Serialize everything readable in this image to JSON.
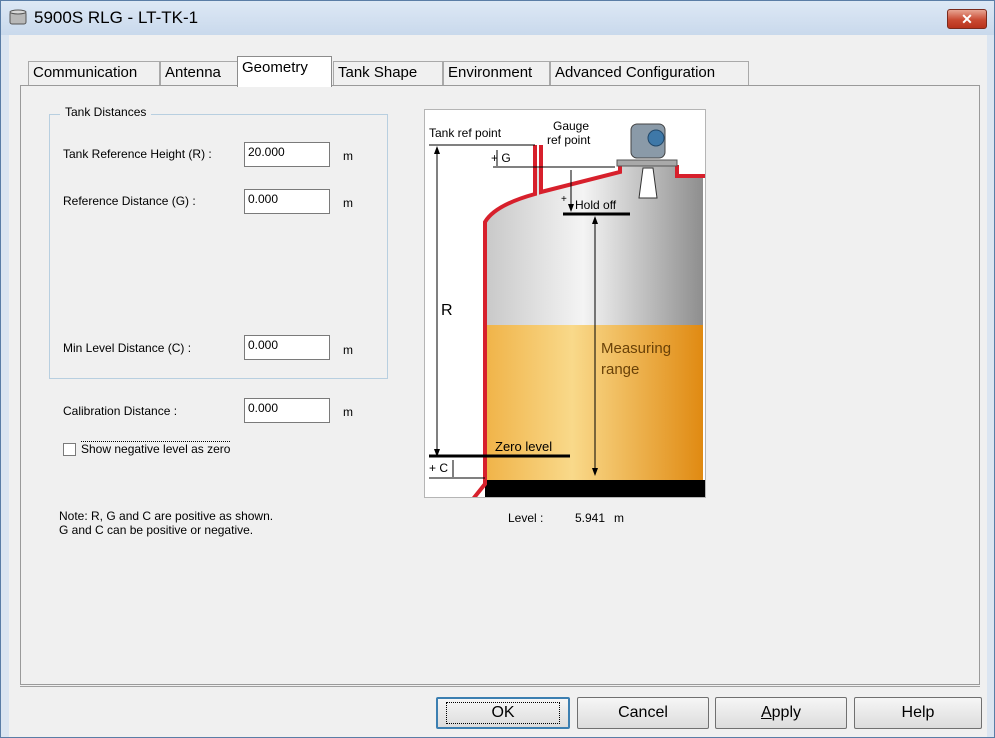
{
  "window": {
    "title": "5900S RLG  - LT-TK-1",
    "close_glyph": "✕"
  },
  "tabs": [
    {
      "label": "Communication"
    },
    {
      "label": "Antenna"
    },
    {
      "label": "Geometry"
    },
    {
      "label": "Tank Shape"
    },
    {
      "label": "Environment"
    },
    {
      "label": "Advanced Configuration"
    }
  ],
  "tank_distances": {
    "group_title": "Tank Distances",
    "ref_height": {
      "label": "Tank Reference Height (R) :",
      "value": "20.000",
      "unit": "m"
    },
    "ref_distance": {
      "label": "Reference Distance (G) :",
      "value": "0.000",
      "unit": "m"
    },
    "min_level": {
      "label": "Min Level Distance (C) :",
      "value": "0.000",
      "unit": "m"
    }
  },
  "calibration": {
    "label": "Calibration Distance :",
    "value": "0.000",
    "unit": "m"
  },
  "show_negative": {
    "label": "Show negative level as zero",
    "checked": false
  },
  "note": {
    "line1": "Note: R, G and C are positive as shown.",
    "line2": "G and C can be positive or negative."
  },
  "diagram": {
    "tank_ref_point": "Tank ref point",
    "gauge_line1": "Gauge",
    "gauge_line2": "ref point",
    "g_label": "+ G",
    "hold_off": "Hold off",
    "r_label": "R",
    "measuring_line1": "Measuring",
    "measuring_line2": "range",
    "zero_level": "Zero level",
    "c_label": "+ C",
    "plus": "+"
  },
  "level": {
    "label": "Level :",
    "value": "5.941",
    "unit": "m"
  },
  "buttons": {
    "ok": "OK",
    "cancel": "Cancel",
    "apply_prefix": "A",
    "apply_rest": "pply",
    "help": "Help"
  },
  "colors": {
    "accent": "#3c7fb1",
    "tank_liquid": "#e8a12a",
    "tank_wall": "#d7202c",
    "close_button": "#c94a32"
  }
}
